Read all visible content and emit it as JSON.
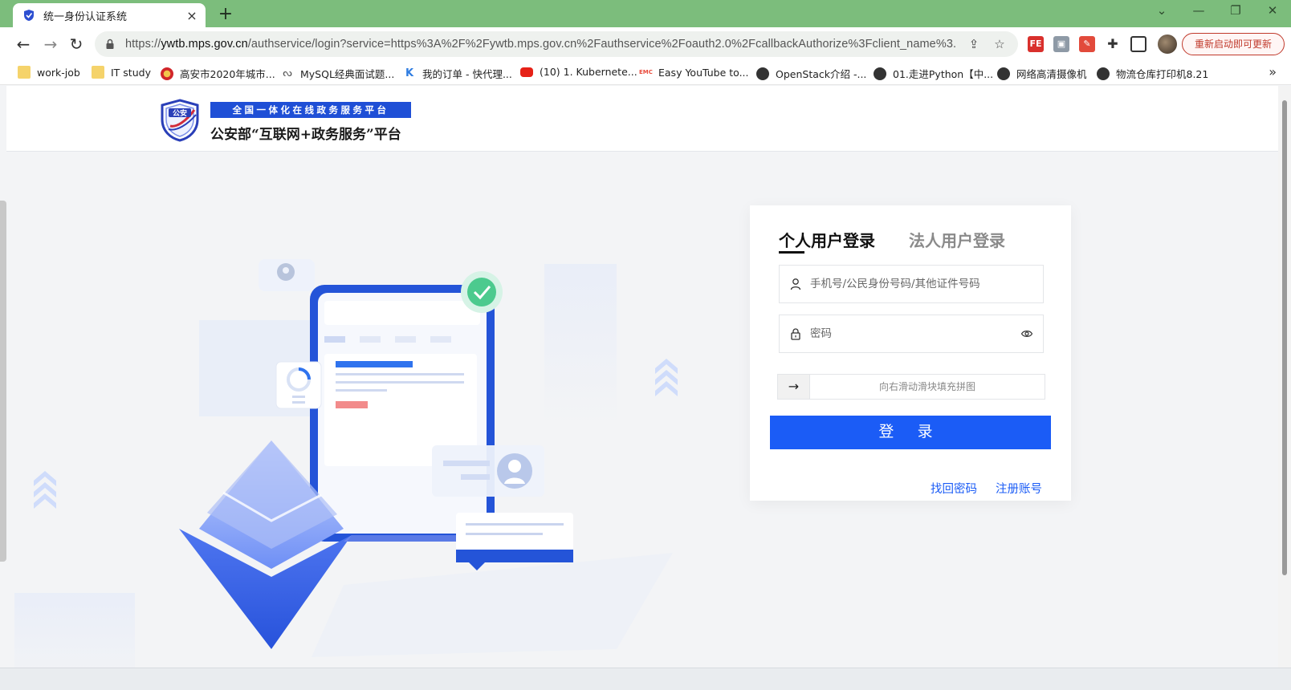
{
  "browser": {
    "tab": {
      "title": "统一身份认证系统",
      "close_glyph": "×"
    },
    "new_tab_glyph": "+",
    "window_controls": {
      "dropdown": "⌄",
      "minimize": "—",
      "restore": "❐",
      "close": "✕"
    },
    "nav": {
      "back": "←",
      "forward": "→",
      "reload": "↻"
    },
    "url": {
      "scheme": "https://",
      "host": "ywtb.mps.gov.cn",
      "path": "/authservice/login?service=https%3A%2F%2Fywtb.mps.gov.cn%2Fauthservice%2Foauth2.0%2FcallbackAuthorize%3Fclient_name%3..."
    },
    "update_button": "重新启动即可更新",
    "bookmarks": [
      {
        "label": "work-job",
        "icon": "folder-icon"
      },
      {
        "label": "IT study",
        "icon": "folder-icon"
      },
      {
        "label": "高安市2020年城市...",
        "icon": "emblem-icon"
      },
      {
        "label": "MySQL经典面试题...",
        "icon": "dolphin-icon"
      },
      {
        "label": "我的订单 - 快代理...",
        "icon": "k-icon"
      },
      {
        "label": "(10) 1. Kubernete...",
        "icon": "youtube-icon"
      },
      {
        "label": "Easy YouTube to...",
        "icon": "emc-icon"
      },
      {
        "label": "OpenStack介绍 -...",
        "icon": "globe-icon"
      },
      {
        "label": "01.走进Python【中...",
        "icon": "globe-icon"
      },
      {
        "label": "网络高清摄像机",
        "icon": "globe-icon"
      },
      {
        "label": "物流仓库打印机8.21",
        "icon": "globe-icon"
      }
    ],
    "bookmarks_more": "»",
    "colors": {
      "tabstrip": "#7cbd7c",
      "accent": "#1b5cf6"
    }
  },
  "site": {
    "logo_badge": "公安",
    "banner": "全国一体化在线政务服务平台",
    "title": "公安部“互联网+政务服务”平台"
  },
  "login": {
    "tabs": {
      "personal": "个人用户登录",
      "legal": "法人用户登录"
    },
    "username_placeholder": "手机号/公民身份号码/其他证件号码",
    "password_placeholder": "密码",
    "slider_handle": "→",
    "slider_hint": "向右滑动滑块填充拼图",
    "submit": "登 录",
    "forgot": "找回密码",
    "register": "注册账号"
  }
}
